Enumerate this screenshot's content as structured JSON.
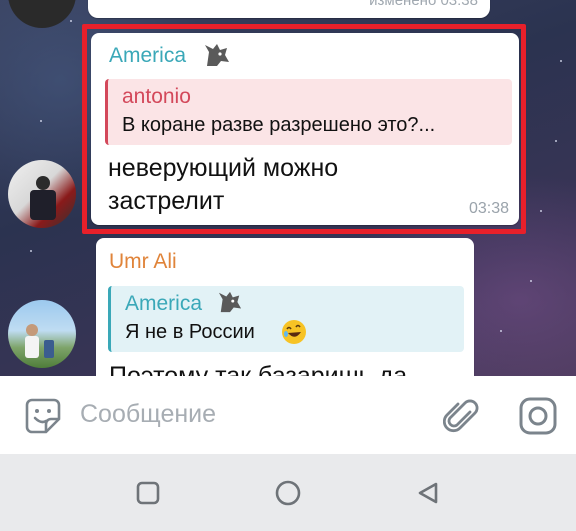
{
  "chat": {
    "previous_message": {
      "edited_label": "изменено 03:38"
    },
    "highlighted_message": {
      "sender": "America",
      "sender_color": "#3aa8b8",
      "reply_to": {
        "name": "antonio",
        "name_color": "#d3485a",
        "text": "В коране разве разрешено это?..."
      },
      "text_line1": "неверующий можно",
      "text_line2": "застрелит",
      "time": "03:38",
      "highlight_color": "#e8202a"
    },
    "next_message": {
      "sender": "Umr Ali",
      "sender_color": "#e0843a",
      "reply_to": {
        "name": "America",
        "name_color": "#3aa8b8",
        "text": "Я не в России"
      },
      "text_partial": "Поэтому так базаришь да"
    }
  },
  "composer": {
    "placeholder": "Сообщение",
    "icons": [
      "emoji-sticker-icon",
      "attach-icon",
      "camera-icon"
    ]
  },
  "navigation": {
    "icons": [
      "recent-apps-icon",
      "home-icon",
      "back-icon"
    ]
  }
}
